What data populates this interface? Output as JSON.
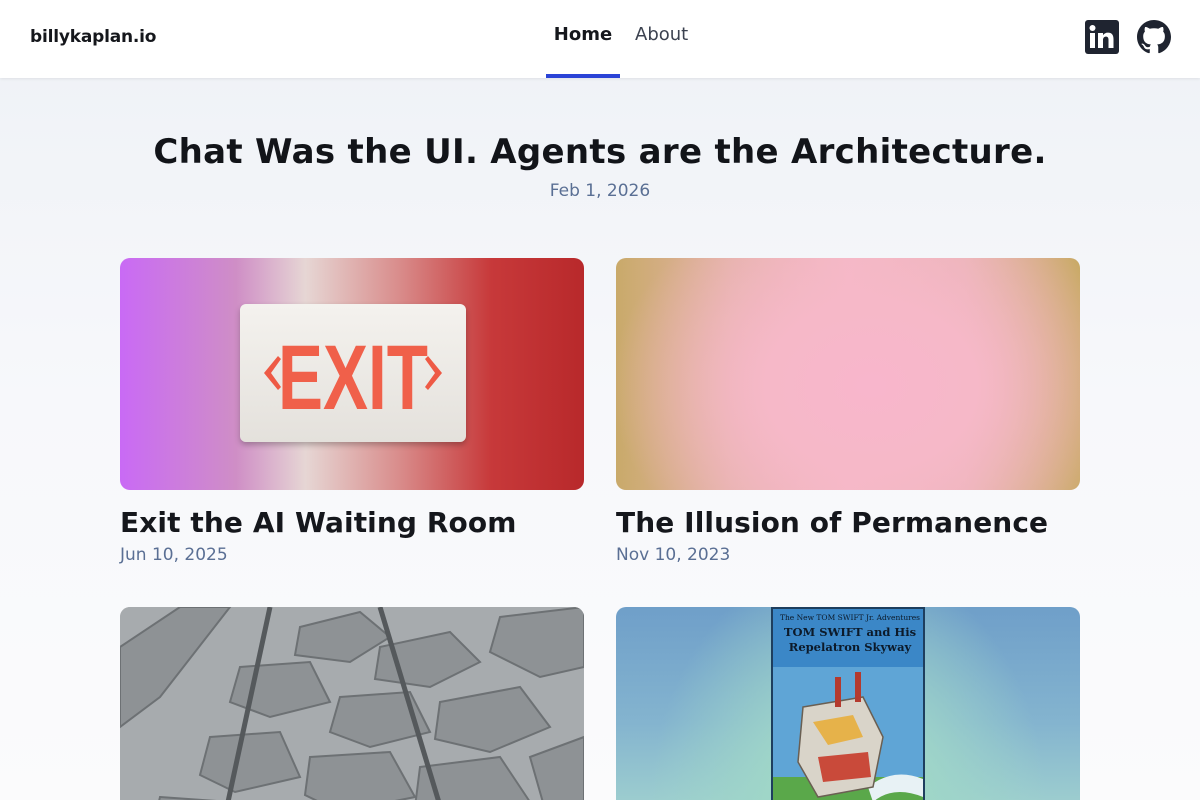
{
  "header": {
    "brand": "billykaplan.io",
    "nav": [
      {
        "label": "Home",
        "active": true
      },
      {
        "label": "About",
        "active": false
      }
    ],
    "social": [
      {
        "icon": "linkedin-icon"
      },
      {
        "icon": "github-icon"
      }
    ],
    "accent_color": "#2a43d6"
  },
  "hero": {
    "title": "Chat Was the UI. Agents are the Architecture.",
    "date": "Feb 1, 2026"
  },
  "posts": [
    {
      "title": "Exit the AI Waiting Room",
      "date": "Jun 10, 2025",
      "image": "exit-sign-image",
      "image_text": "EXIT"
    },
    {
      "title": "The Illusion of Permanence",
      "date": "Nov 10, 2023",
      "image": "pink-gradient-image"
    },
    {
      "title": "",
      "date": "",
      "image": "stone-road-image"
    },
    {
      "title": "",
      "date": "",
      "image": "book-cover-image",
      "book_kicker": "The New TOM SWIFT Jr. Adventures",
      "book_title": "TOM SWIFT and His Repelatron Skyway"
    }
  ]
}
